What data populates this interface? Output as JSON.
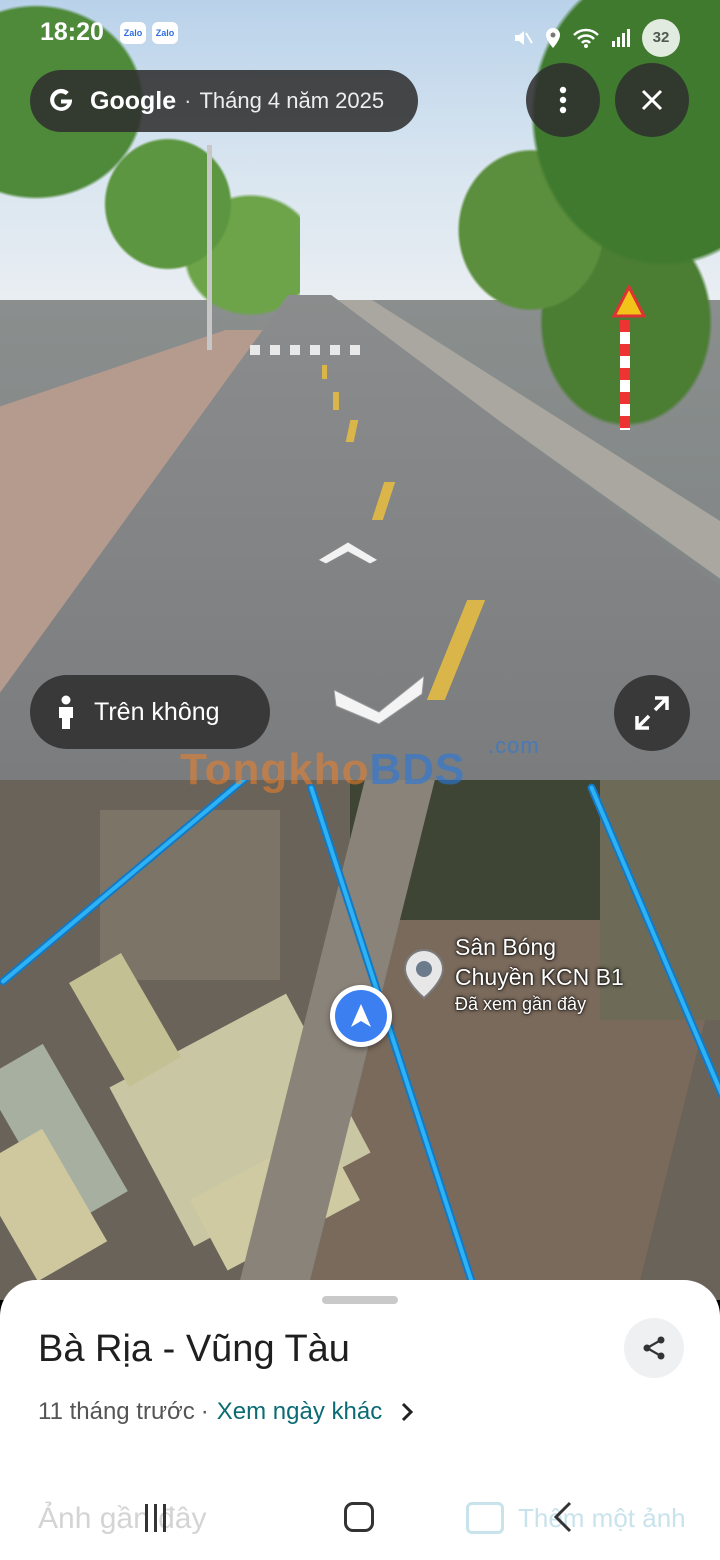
{
  "status_bar": {
    "time": "18:20",
    "notification_icons": [
      "Zalo",
      "Zalo"
    ],
    "battery": "32"
  },
  "streetview": {
    "brand": "Google",
    "separator": "·",
    "capture_date": "Tháng 4 năm 2025",
    "aerial_toggle_label": "Trên không",
    "icons": [
      "google-g-icon",
      "more-vert-icon",
      "close-icon",
      "person-icon",
      "expand-icon",
      "arrow-up-icon",
      "arrow-down-icon"
    ]
  },
  "map": {
    "place_name_line1": "Sân Bóng",
    "place_name_line2": "Chuyền KCN B1",
    "place_subtitle": "Đã xem gần đây",
    "watermark": {
      "part1": "Tongkho",
      "part2": "BDS",
      "suffix": ".com"
    },
    "route_color": "#2cb2f5",
    "location_dot_color": "#3b7ff1"
  },
  "sheet": {
    "title": "Bà Rịa - Vũng Tàu",
    "age": "11 tháng trước",
    "separator": "·",
    "other_dates_link": "Xem ngày khác",
    "recent_photos_label": "Ảnh gần đây",
    "add_photo_label": "Thêm một ảnh",
    "link_color": "#0b6b74"
  }
}
